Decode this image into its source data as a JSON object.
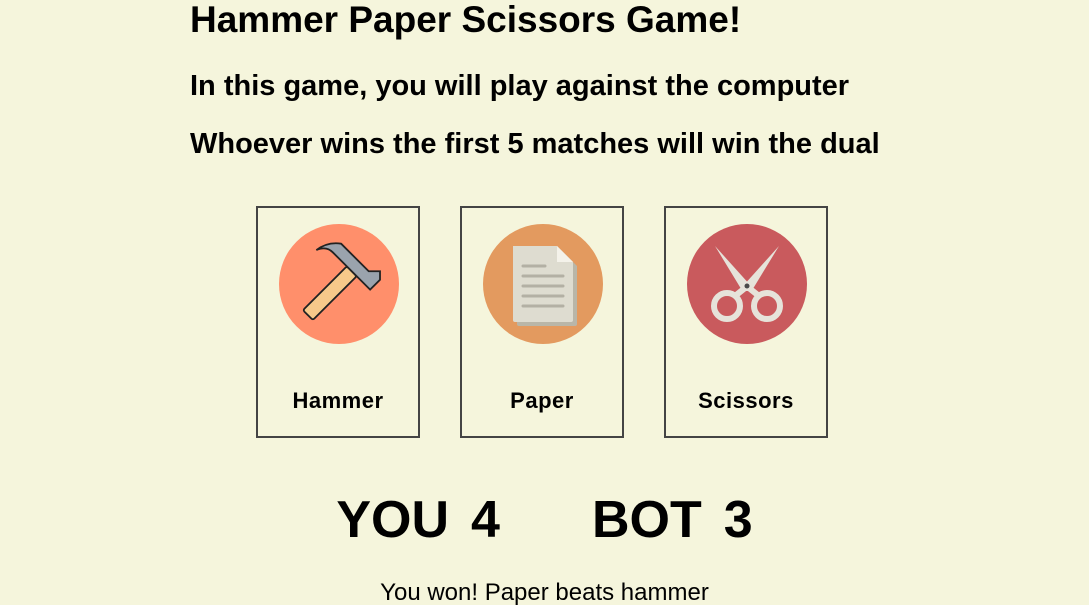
{
  "header": {
    "title": "Hammer Paper Scissors Game!",
    "intro_line_1": "In this game, you will play against the computer",
    "intro_line_2": "Whoever wins the first 5 matches will win the dual"
  },
  "choices": [
    {
      "label": "Hammer",
      "icon": "hammer-icon",
      "color": "#ff8f6b"
    },
    {
      "label": "Paper",
      "icon": "paper-icon",
      "color": "#e39a5f"
    },
    {
      "label": "Scissors",
      "icon": "scissors-icon",
      "color": "#c95a5d"
    }
  ],
  "score": {
    "you_label": "YOU",
    "you_score": "4",
    "bot_label": "BOT",
    "bot_score": "3"
  },
  "result": {
    "message": "You won! Paper beats hammer"
  },
  "colors": {
    "background": "#f5f5dc",
    "card_border": "#444444"
  }
}
